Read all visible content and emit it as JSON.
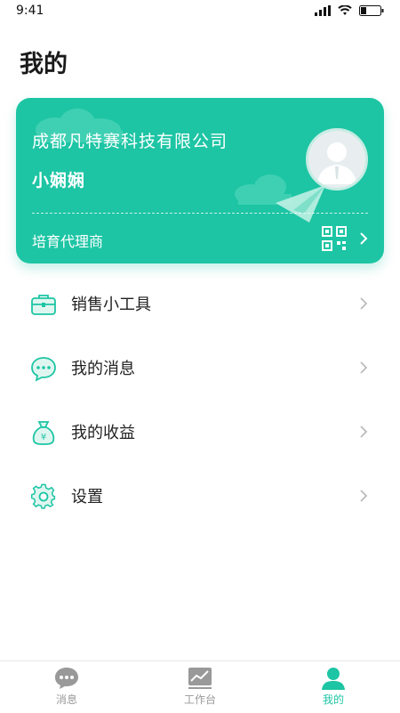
{
  "status": {
    "time": "9:41"
  },
  "page": {
    "title": "我的"
  },
  "card": {
    "company": "成都凡特赛科技有限公司",
    "username": "小娴娴",
    "role": "培育代理商"
  },
  "menu": [
    {
      "label": "销售小工具",
      "icon": "briefcase-icon"
    },
    {
      "label": "我的消息",
      "icon": "chat-bubble-icon"
    },
    {
      "label": "我的收益",
      "icon": "money-bag-icon"
    },
    {
      "label": "设置",
      "icon": "gear-icon"
    }
  ],
  "tabs": [
    {
      "label": "消息",
      "icon": "chat-bubble-icon",
      "active": false
    },
    {
      "label": "工作台",
      "icon": "dashboard-icon",
      "active": false
    },
    {
      "label": "我的",
      "icon": "user-icon",
      "active": true
    }
  ],
  "colors": {
    "accent": "#1dc5a4",
    "inactive": "#999999"
  }
}
